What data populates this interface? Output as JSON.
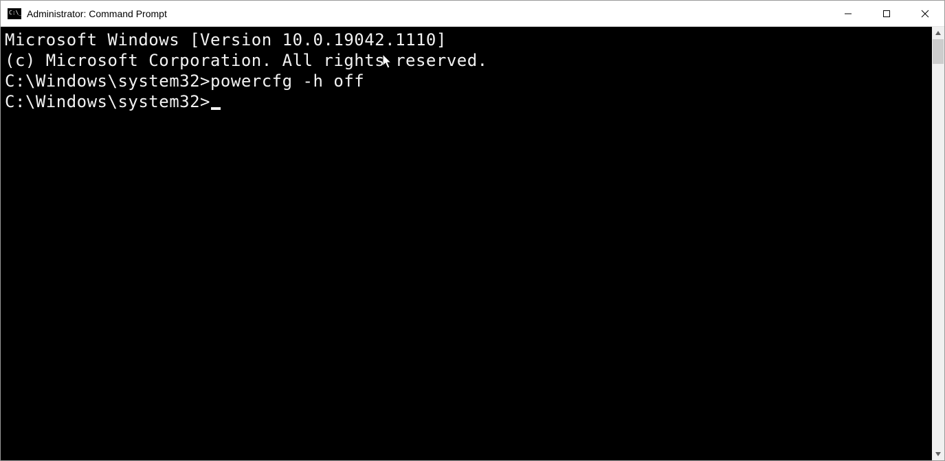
{
  "titlebar": {
    "title": "Administrator: Command Prompt"
  },
  "terminal": {
    "line1": "Microsoft Windows [Version 10.0.19042.1110]",
    "line2": "(c) Microsoft Corporation. All rights reserved.",
    "blank1": "",
    "prompt1": "C:\\Windows\\system32>",
    "command1": "powercfg -h off",
    "blank2": "",
    "prompt2": "C:\\Windows\\system32>"
  }
}
